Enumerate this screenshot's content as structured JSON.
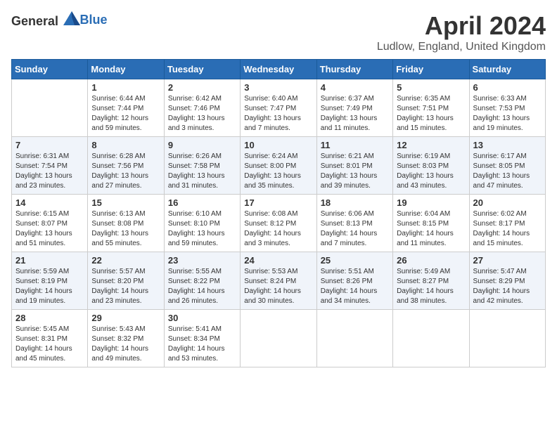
{
  "header": {
    "logo_general": "General",
    "logo_blue": "Blue",
    "title": "April 2024",
    "location": "Ludlow, England, United Kingdom"
  },
  "weekdays": [
    "Sunday",
    "Monday",
    "Tuesday",
    "Wednesday",
    "Thursday",
    "Friday",
    "Saturday"
  ],
  "weeks": [
    [
      {
        "day": "",
        "info": ""
      },
      {
        "day": "1",
        "info": "Sunrise: 6:44 AM\nSunset: 7:44 PM\nDaylight: 12 hours\nand 59 minutes."
      },
      {
        "day": "2",
        "info": "Sunrise: 6:42 AM\nSunset: 7:46 PM\nDaylight: 13 hours\nand 3 minutes."
      },
      {
        "day": "3",
        "info": "Sunrise: 6:40 AM\nSunset: 7:47 PM\nDaylight: 13 hours\nand 7 minutes."
      },
      {
        "day": "4",
        "info": "Sunrise: 6:37 AM\nSunset: 7:49 PM\nDaylight: 13 hours\nand 11 minutes."
      },
      {
        "day": "5",
        "info": "Sunrise: 6:35 AM\nSunset: 7:51 PM\nDaylight: 13 hours\nand 15 minutes."
      },
      {
        "day": "6",
        "info": "Sunrise: 6:33 AM\nSunset: 7:53 PM\nDaylight: 13 hours\nand 19 minutes."
      }
    ],
    [
      {
        "day": "7",
        "info": "Sunrise: 6:31 AM\nSunset: 7:54 PM\nDaylight: 13 hours\nand 23 minutes."
      },
      {
        "day": "8",
        "info": "Sunrise: 6:28 AM\nSunset: 7:56 PM\nDaylight: 13 hours\nand 27 minutes."
      },
      {
        "day": "9",
        "info": "Sunrise: 6:26 AM\nSunset: 7:58 PM\nDaylight: 13 hours\nand 31 minutes."
      },
      {
        "day": "10",
        "info": "Sunrise: 6:24 AM\nSunset: 8:00 PM\nDaylight: 13 hours\nand 35 minutes."
      },
      {
        "day": "11",
        "info": "Sunrise: 6:21 AM\nSunset: 8:01 PM\nDaylight: 13 hours\nand 39 minutes."
      },
      {
        "day": "12",
        "info": "Sunrise: 6:19 AM\nSunset: 8:03 PM\nDaylight: 13 hours\nand 43 minutes."
      },
      {
        "day": "13",
        "info": "Sunrise: 6:17 AM\nSunset: 8:05 PM\nDaylight: 13 hours\nand 47 minutes."
      }
    ],
    [
      {
        "day": "14",
        "info": "Sunrise: 6:15 AM\nSunset: 8:07 PM\nDaylight: 13 hours\nand 51 minutes."
      },
      {
        "day": "15",
        "info": "Sunrise: 6:13 AM\nSunset: 8:08 PM\nDaylight: 13 hours\nand 55 minutes."
      },
      {
        "day": "16",
        "info": "Sunrise: 6:10 AM\nSunset: 8:10 PM\nDaylight: 13 hours\nand 59 minutes."
      },
      {
        "day": "17",
        "info": "Sunrise: 6:08 AM\nSunset: 8:12 PM\nDaylight: 14 hours\nand 3 minutes."
      },
      {
        "day": "18",
        "info": "Sunrise: 6:06 AM\nSunset: 8:13 PM\nDaylight: 14 hours\nand 7 minutes."
      },
      {
        "day": "19",
        "info": "Sunrise: 6:04 AM\nSunset: 8:15 PM\nDaylight: 14 hours\nand 11 minutes."
      },
      {
        "day": "20",
        "info": "Sunrise: 6:02 AM\nSunset: 8:17 PM\nDaylight: 14 hours\nand 15 minutes."
      }
    ],
    [
      {
        "day": "21",
        "info": "Sunrise: 5:59 AM\nSunset: 8:19 PM\nDaylight: 14 hours\nand 19 minutes."
      },
      {
        "day": "22",
        "info": "Sunrise: 5:57 AM\nSunset: 8:20 PM\nDaylight: 14 hours\nand 23 minutes."
      },
      {
        "day": "23",
        "info": "Sunrise: 5:55 AM\nSunset: 8:22 PM\nDaylight: 14 hours\nand 26 minutes."
      },
      {
        "day": "24",
        "info": "Sunrise: 5:53 AM\nSunset: 8:24 PM\nDaylight: 14 hours\nand 30 minutes."
      },
      {
        "day": "25",
        "info": "Sunrise: 5:51 AM\nSunset: 8:26 PM\nDaylight: 14 hours\nand 34 minutes."
      },
      {
        "day": "26",
        "info": "Sunrise: 5:49 AM\nSunset: 8:27 PM\nDaylight: 14 hours\nand 38 minutes."
      },
      {
        "day": "27",
        "info": "Sunrise: 5:47 AM\nSunset: 8:29 PM\nDaylight: 14 hours\nand 42 minutes."
      }
    ],
    [
      {
        "day": "28",
        "info": "Sunrise: 5:45 AM\nSunset: 8:31 PM\nDaylight: 14 hours\nand 45 minutes."
      },
      {
        "day": "29",
        "info": "Sunrise: 5:43 AM\nSunset: 8:32 PM\nDaylight: 14 hours\nand 49 minutes."
      },
      {
        "day": "30",
        "info": "Sunrise: 5:41 AM\nSunset: 8:34 PM\nDaylight: 14 hours\nand 53 minutes."
      },
      {
        "day": "",
        "info": ""
      },
      {
        "day": "",
        "info": ""
      },
      {
        "day": "",
        "info": ""
      },
      {
        "day": "",
        "info": ""
      }
    ]
  ]
}
